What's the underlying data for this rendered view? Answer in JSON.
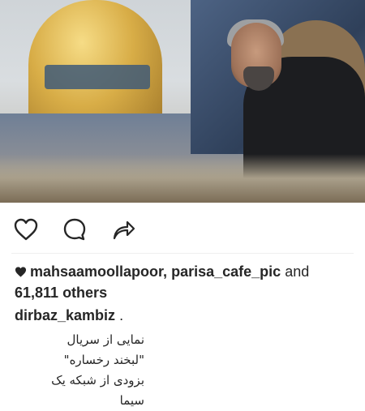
{
  "post": {
    "image_alt": "Actor in front of the golden dome of the shrine",
    "actions": {
      "like_icon": "heart-outline-icon",
      "comment_icon": "speech-bubble-icon",
      "share_icon": "share-arrow-icon"
    },
    "likes": {
      "icon": "heart-filled-icon",
      "user1": "mahsaamoollapoor,",
      "user2": "parisa_cafe_pic",
      "and_text": "and",
      "others": "61,811 others"
    },
    "caption": {
      "username": "dirbaz_kambiz",
      "suffix": ".",
      "lines": [
        "نمایی از سریال",
        "\"لبخند رخساره\"",
        "بزودی از شبکه یک",
        "سیما"
      ]
    }
  }
}
